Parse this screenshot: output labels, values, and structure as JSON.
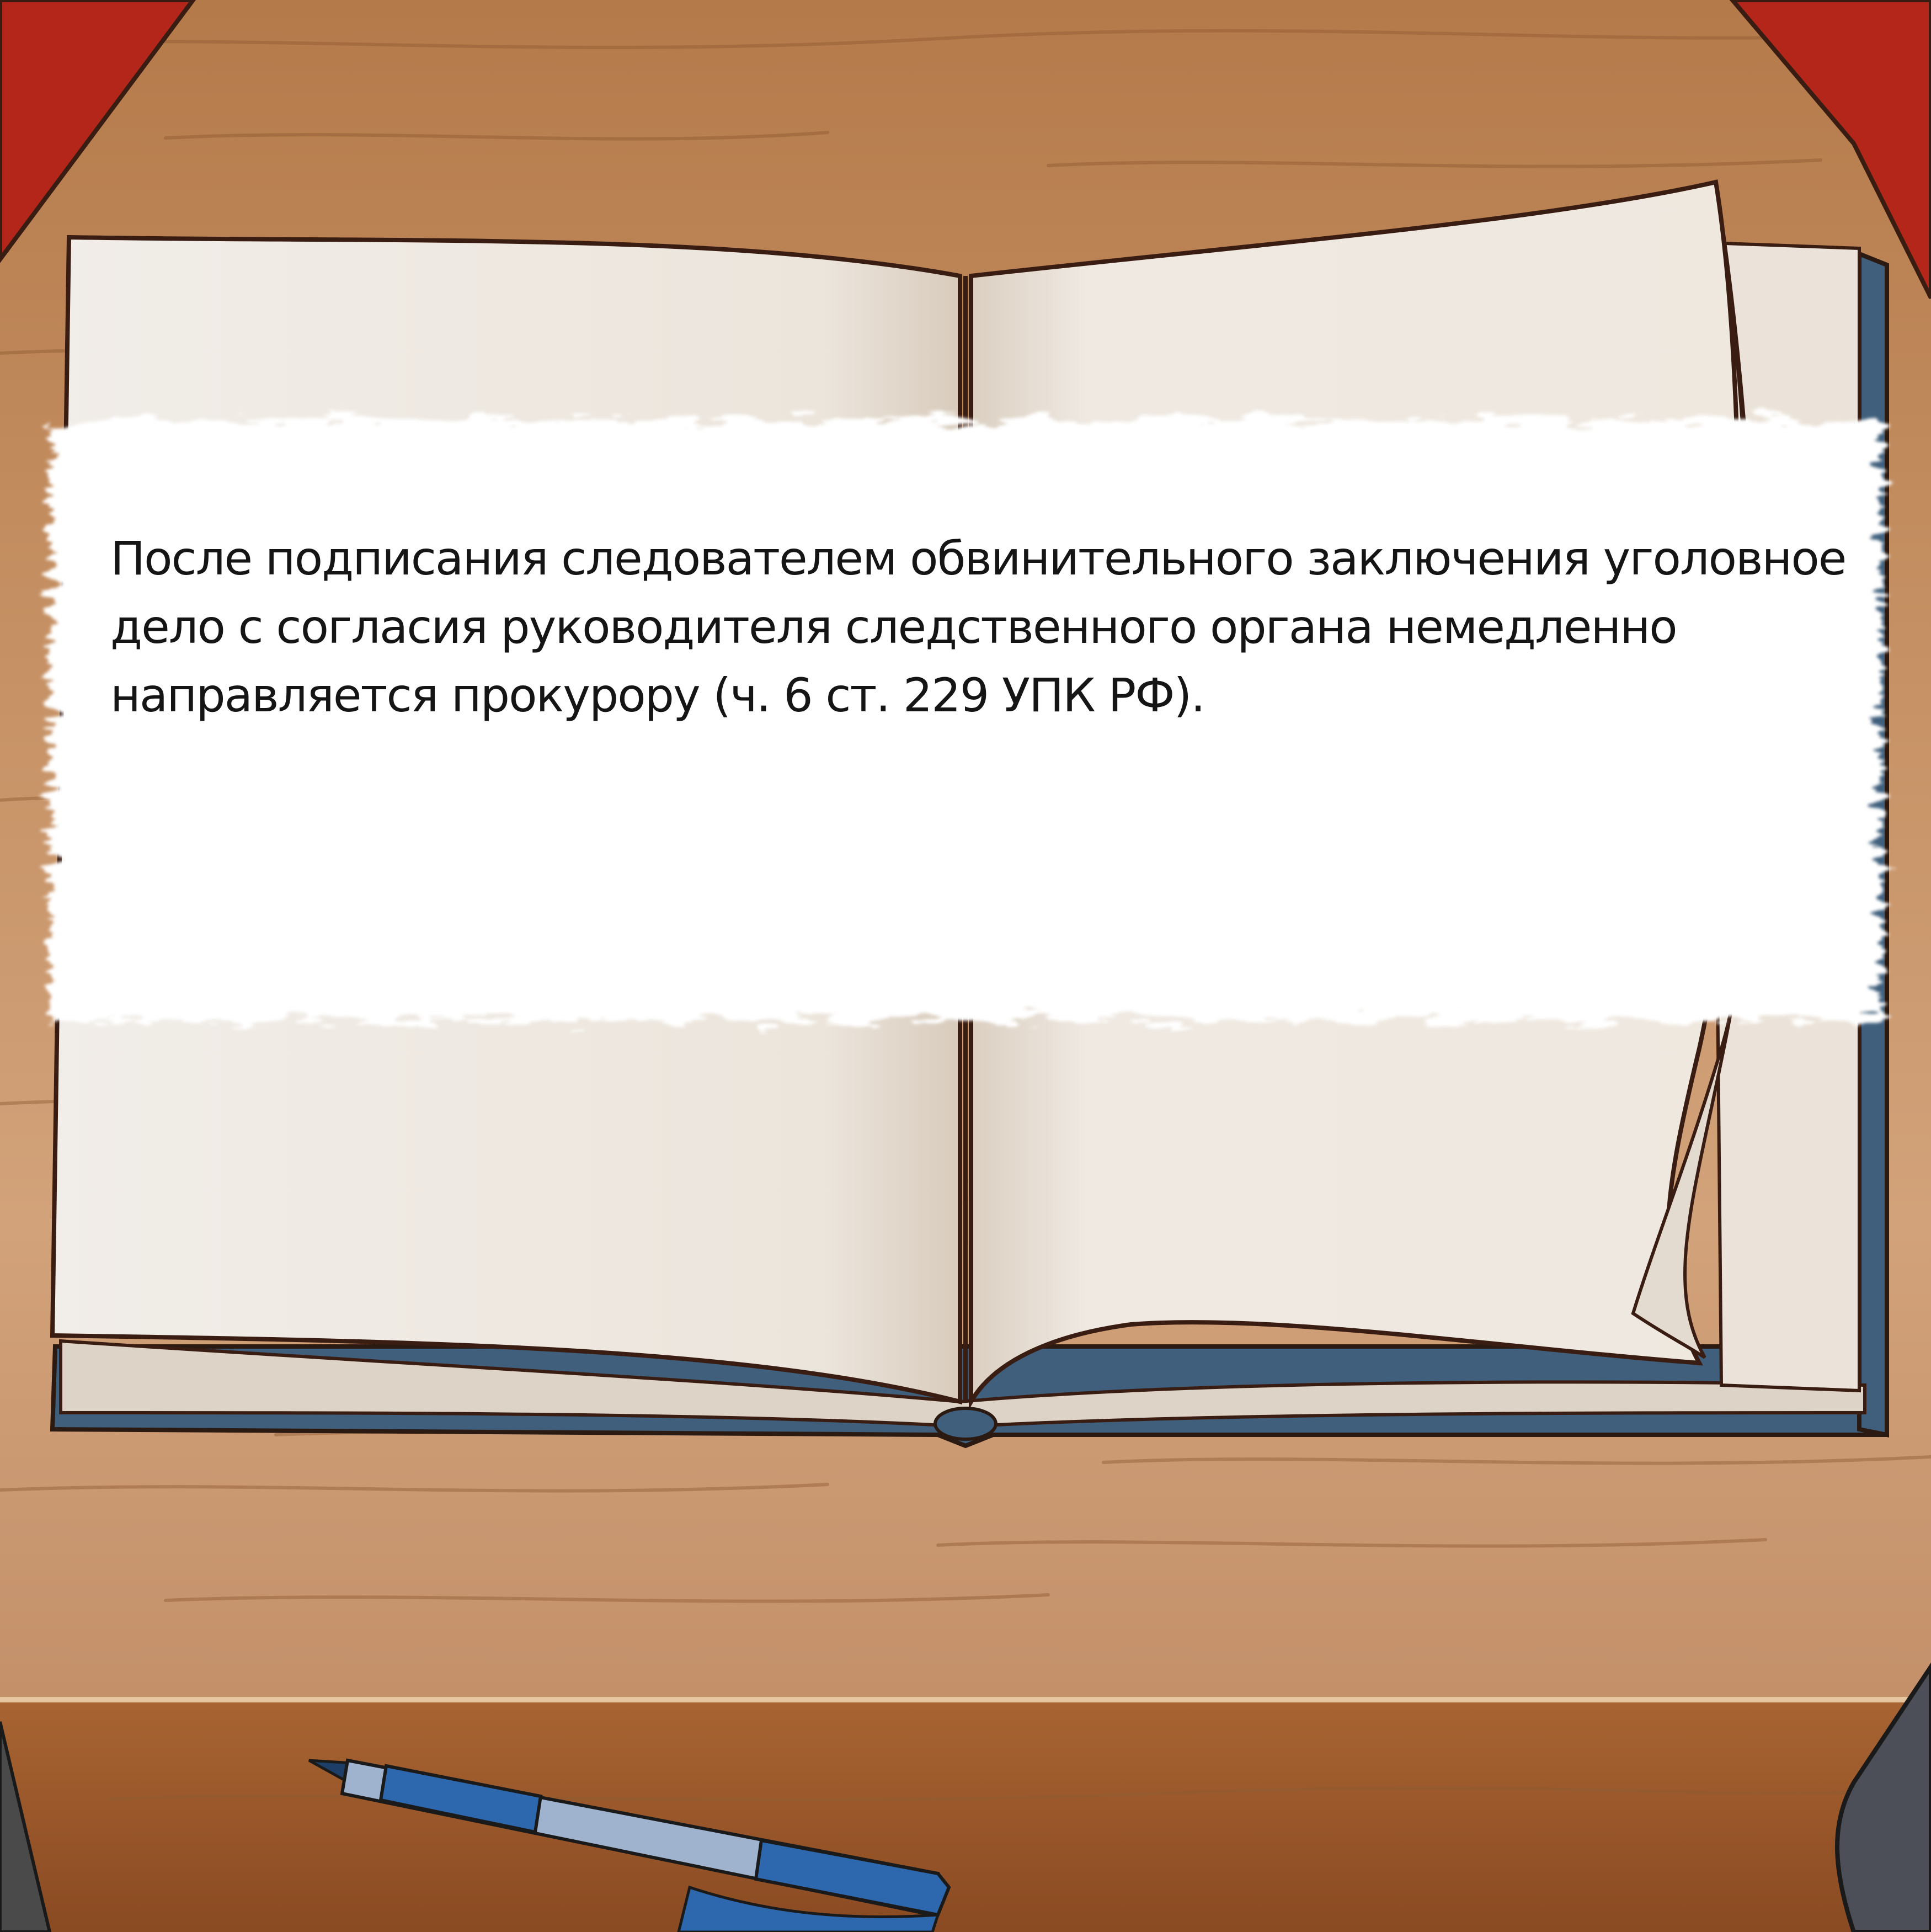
{
  "caption": {
    "text": "После подписания следователем обвинительного заключения уголовное дело с согласия руководителя следственного органа немедленно направляется прокурору (ч. 6 ст. 229 УПК РФ)."
  },
  "colors": {
    "desk_light": "#c89466",
    "desk_dark": "#8f5126",
    "outline": "#3a1d12",
    "page": "#efe9e2",
    "book_cover": "#3f5f7c",
    "red_book": "#b4261a",
    "pen_blue": "#2d67ad",
    "highlight": "#ffffff"
  },
  "icons": {
    "book": "open-book-icon",
    "pen": "pen-icon"
  }
}
